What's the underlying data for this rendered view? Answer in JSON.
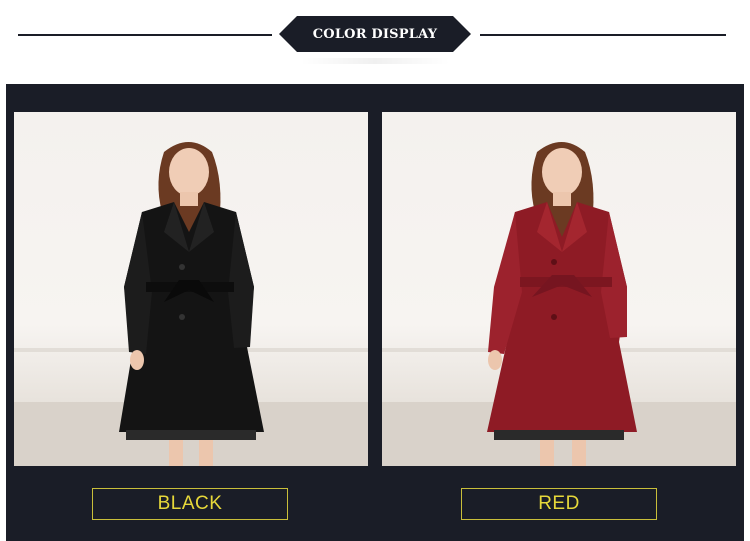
{
  "header": {
    "title": "COLOR DISPLAY"
  },
  "colors": {
    "dark_bg": "#1a1d27",
    "label_text": "#e6d83a",
    "label_border": "#c9bf3a",
    "coat_black": "#141414",
    "coat_red": "#8e1b25"
  },
  "variants": [
    {
      "label": "BLACK",
      "coat_color": "#141414",
      "image": "model-black-coat"
    },
    {
      "label": "RED",
      "coat_color": "#8e1b25",
      "image": "model-red-coat"
    }
  ]
}
